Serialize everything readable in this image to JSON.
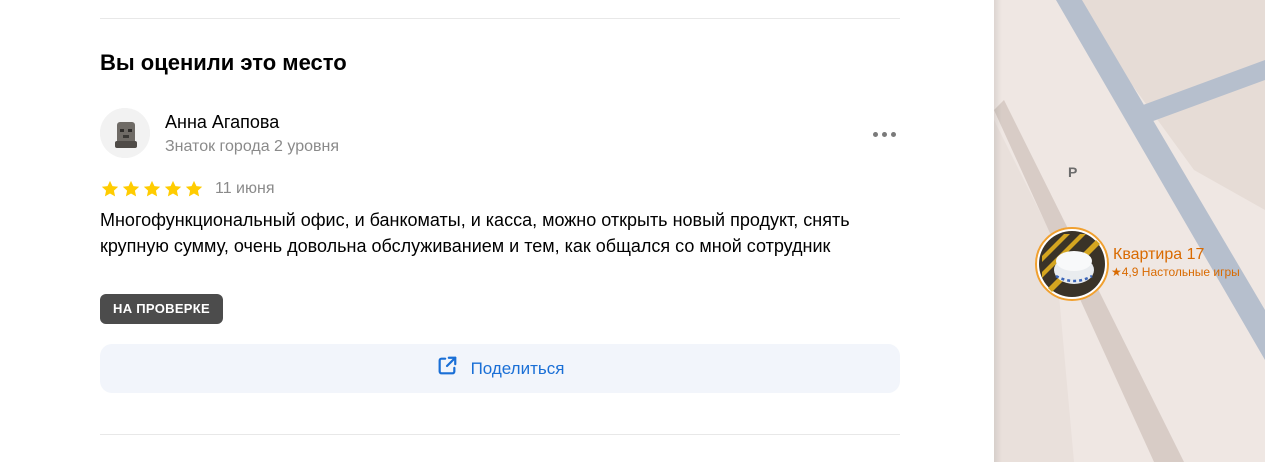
{
  "review_section": {
    "title": "Вы оценили это место",
    "author": {
      "name": "Анна Агапова",
      "level": "Знаток города 2 уровня"
    },
    "rating": 5,
    "date": "11 июня",
    "text": "Многофункциональный офис, и банкоматы, и касса, можно открыть новый продукт, снять крупную сумму, очень довольна обслуживанием и тем, как общался со мной сотрудник",
    "status_badge": "НА ПРОВЕРКЕ",
    "share_label": "Поделиться",
    "icons": {
      "menu": "more-dots-icon",
      "star": "star-icon",
      "share": "share-external-icon"
    },
    "colors": {
      "star": "#ffcc00",
      "badge_bg": "#4c4c4c",
      "share_text": "#1a6fd6",
      "share_bg": "#f2f5fb"
    }
  },
  "map": {
    "parking_label": "P",
    "place_pin": {
      "title": "Квартира 17",
      "subtitle": "★4,9 Настольные игры",
      "color": "#d96a00"
    }
  }
}
